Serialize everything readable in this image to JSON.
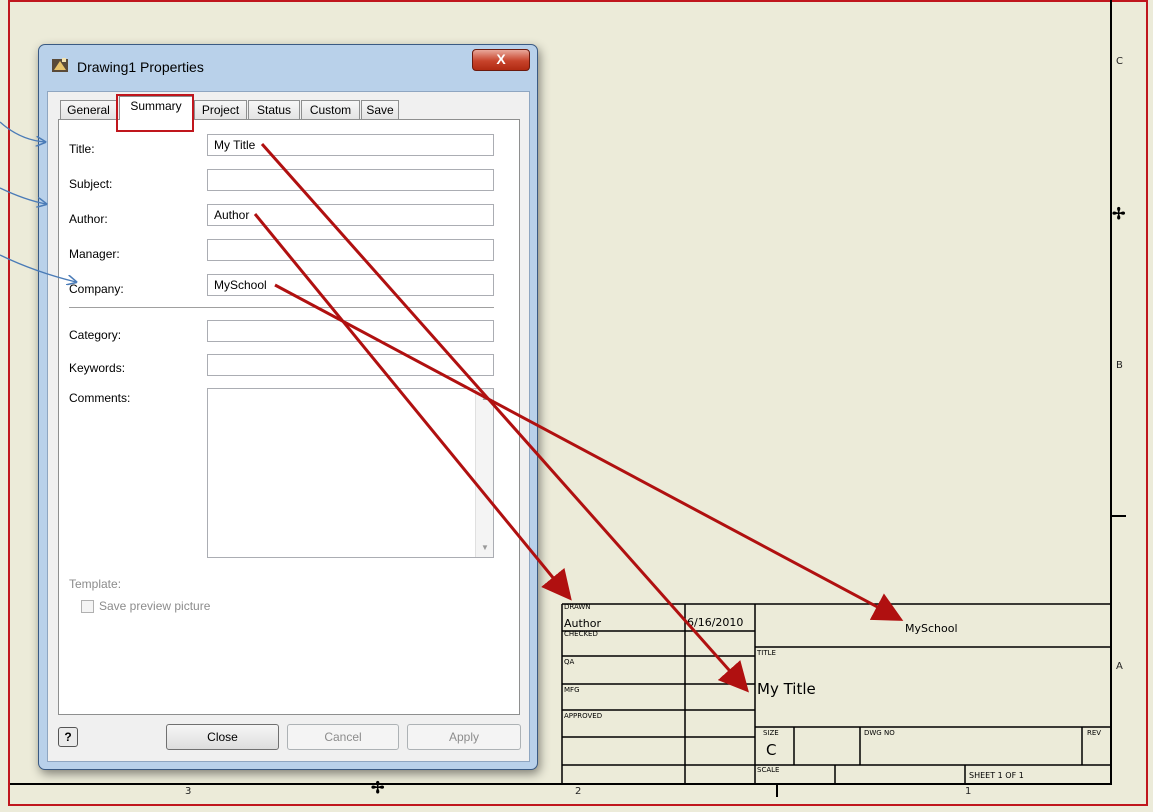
{
  "dialog": {
    "title": "Drawing1 Properties",
    "close_glyph": "X",
    "tabs": [
      "General",
      "Summary",
      "Project",
      "Status",
      "Custom",
      "Save"
    ],
    "active_tab": "Summary",
    "fields": {
      "title_label": "Title:",
      "title_value": "My Title",
      "subject_label": "Subject:",
      "subject_value": "",
      "author_label": "Author:",
      "author_value": "Author",
      "manager_label": "Manager:",
      "manager_value": "",
      "company_label": "Company:",
      "company_value": "MySchool",
      "category_label": "Category:",
      "category_value": "",
      "keywords_label": "Keywords:",
      "keywords_value": "",
      "comments_label": "Comments:"
    },
    "template_label": "Template:",
    "save_preview_label": "Save preview picture",
    "help_glyph": "?",
    "buttons": {
      "close": "Close",
      "cancel": "Cancel",
      "apply": "Apply"
    }
  },
  "title_block": {
    "drawn_label": "DRAWN",
    "drawn_value": "Author",
    "drawn_date": "6/16/2010",
    "checked_label": "CHECKED",
    "qa_label": "QA",
    "mfg_label": "MFG",
    "approved_label": "APPROVED",
    "company": "MySchool",
    "title_label": "TITLE",
    "title_value": "My Title",
    "size_label": "SIZE",
    "size_value": "C",
    "dwg_no_label": "DWG NO",
    "rev_label": "REV",
    "scale_label": "SCALE",
    "sheet_label": "SHEET 1  OF 1"
  },
  "zones": {
    "right": [
      "C",
      "B",
      "A"
    ],
    "bottom": [
      "3",
      "2",
      "1"
    ]
  },
  "colors": {
    "annotation_red": "#b01010",
    "callout_blue": "#4a7bb7",
    "sheet_bg": "#ecebd9"
  }
}
